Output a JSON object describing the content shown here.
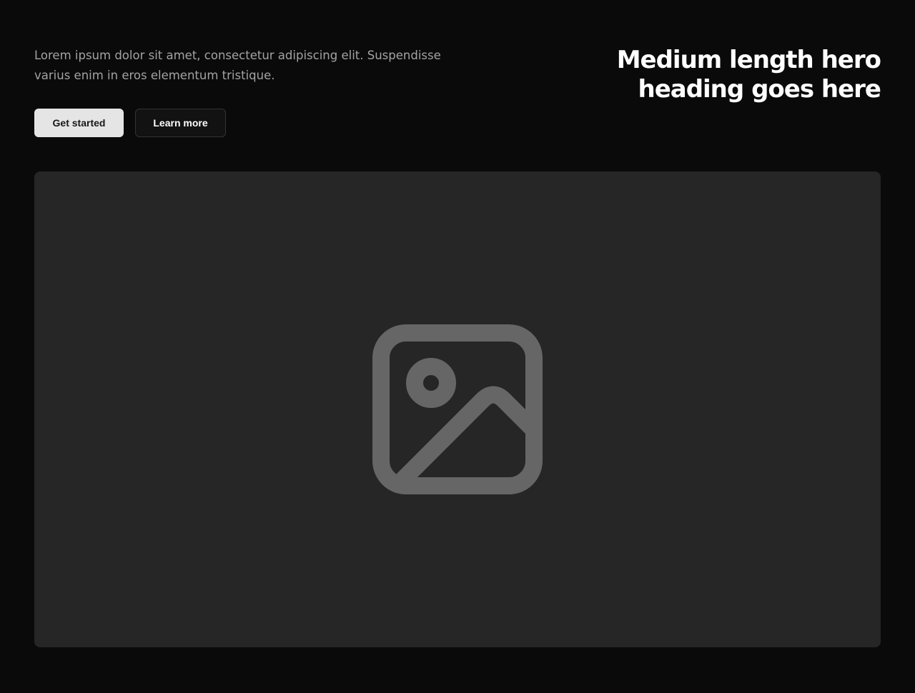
{
  "hero": {
    "description": "Lorem ipsum dolor sit amet, consectetur adipiscing elit. Suspendisse varius enim in eros elementum tristique.",
    "heading_line1": "Medium length hero",
    "heading_line2": "heading goes here",
    "primary_button": "Get started",
    "secondary_button": "Learn more",
    "media_icon": "image-placeholder-icon"
  },
  "colors": {
    "background": "#0a0a0a",
    "text_muted": "#a3a3a3",
    "heading": "#ffffff",
    "primary_button_bg": "#e5e5e5",
    "secondary_button_bg": "#121212",
    "media_bg": "#262626",
    "icon": "#666666"
  }
}
